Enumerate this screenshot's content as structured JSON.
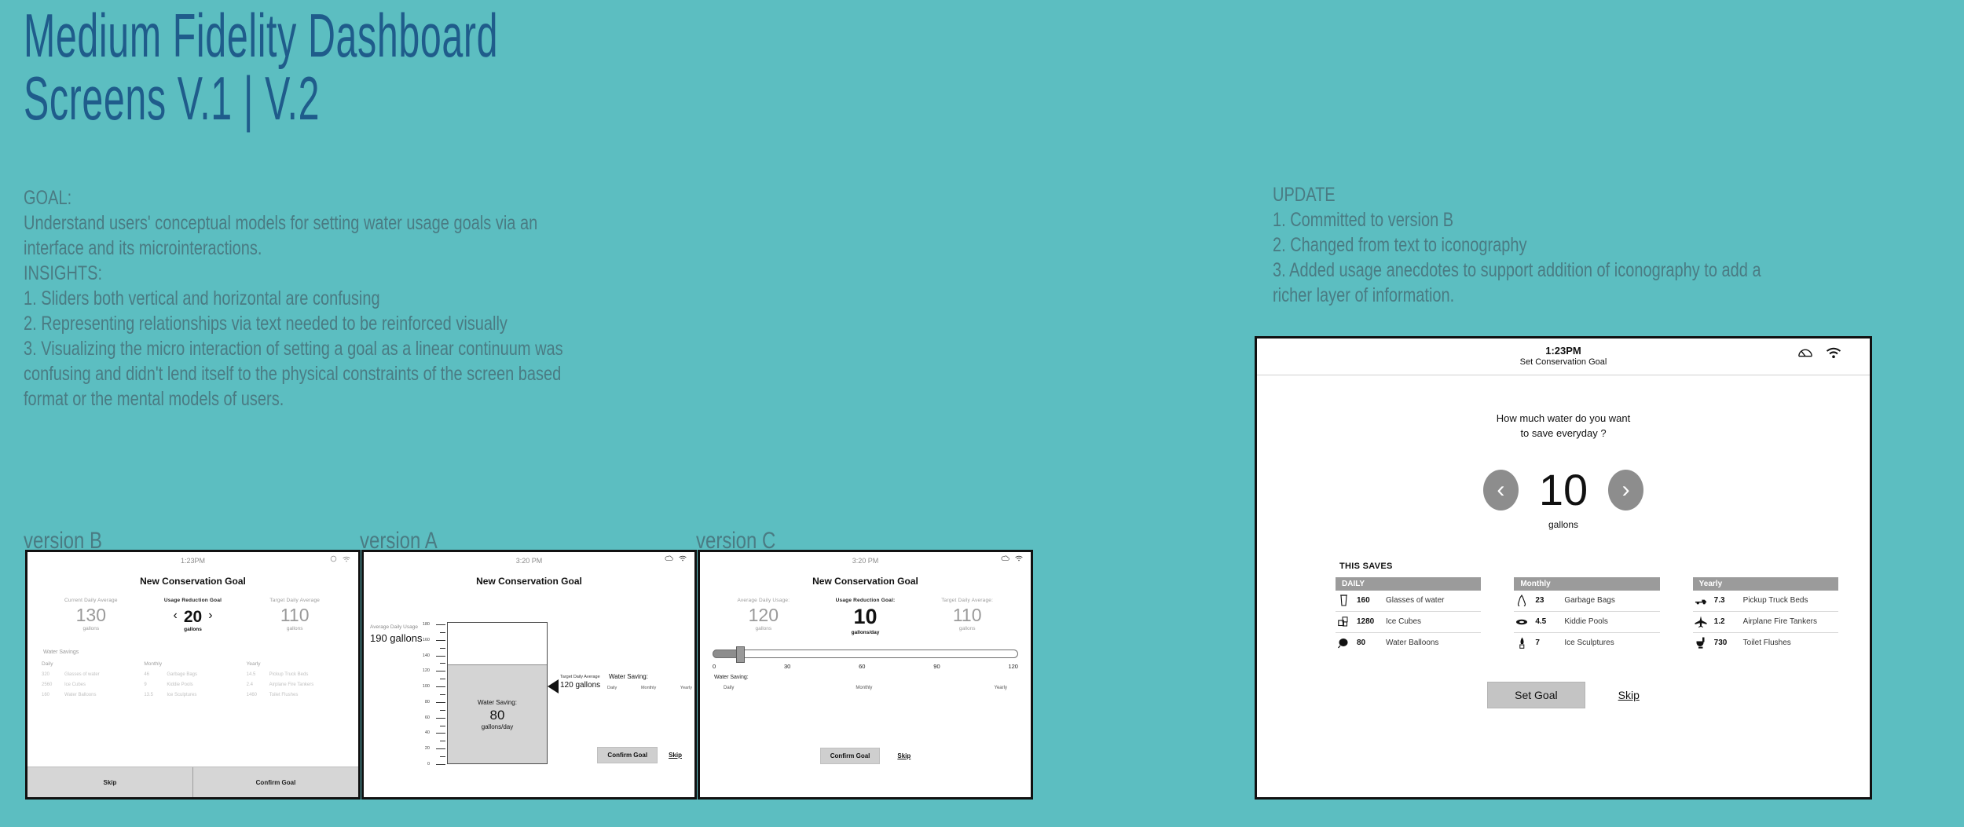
{
  "headline": "Medium Fidelity Dashboard\nScreens V.1 | V.2",
  "goal_copy": "GOAL:\nUnderstand users' conceptual models for setting water usage goals via an interface and its microinteractions.\nINSIGHTS:\n1. Sliders both vertical and horizontal are confusing\n2. Representing relationships via text needed to be reinforced visually\n3. Visualizing the micro interaction of setting a goal as a linear continuum  was confusing and didn't lend itself to the physical constraints of the screen based format or the mental models of users.",
  "update_copy": "UPDATE\n1. Committed to version B\n2. Changed from text to iconography\n3. Added usage anecdotes to support addition of iconography to add a richer layer of information.",
  "labels": {
    "version_b": "version B",
    "version_a": "version A",
    "version_c": "version C"
  },
  "version_b": {
    "status_time": "1:23PM",
    "title": "New Conservation Goal",
    "current": {
      "caption": "Current Daily Average",
      "value": "130",
      "unit": "gallons"
    },
    "goal": {
      "caption": "Usage Reduction Goal",
      "value": "20",
      "unit": "gallons",
      "prev": "‹",
      "next": "›"
    },
    "target": {
      "caption": "Target Daily Average",
      "value": "110",
      "unit": "gallons"
    },
    "savings_header": "Water Savings",
    "columns": [
      "Daily",
      "Monthly",
      "Yearly"
    ],
    "daily": [
      {
        "value": "320",
        "label": "Glasses of water"
      },
      {
        "value": "2560",
        "label": "Ice Cubes"
      },
      {
        "value": "160",
        "label": "Water Balloons"
      }
    ],
    "monthly": [
      {
        "value": "46",
        "label": "Garbage Bags"
      },
      {
        "value": "9",
        "label": "Kiddie Pools"
      },
      {
        "value": "13.5",
        "label": "Ice Sculptures"
      }
    ],
    "yearly": [
      {
        "value": "14.5",
        "label": "Pickup Truck Beds"
      },
      {
        "value": "2.4",
        "label": "Airplane Fire Tankers"
      },
      {
        "value": "1460",
        "label": "Toilet Flushes"
      }
    ],
    "skip_label": "Skip",
    "confirm_label": "Confirm Goal"
  },
  "version_a": {
    "status_time": "3:20 PM",
    "title": "New Conservation Goal",
    "avg_caption": "Average Daily Usage",
    "avg_value": "190 gallons",
    "axis_ticks": [
      "180",
      "160",
      "140",
      "120",
      "100",
      "80",
      "60",
      "40",
      "20",
      "0"
    ],
    "pointer_caption": "Target Daily Average",
    "pointer_value": "120 gallons",
    "saving_label": "Water Saving:",
    "saving_value": "80",
    "saving_unit": "gallons/day",
    "savings_header": "Water Saving:",
    "columns": [
      "Daily",
      "Monthly",
      "Yearly"
    ],
    "confirm_label": "Confirm Goal",
    "skip_label": "Skip"
  },
  "version_c": {
    "status_time": "3:20 PM",
    "title": "New Conservation Goal",
    "current": {
      "caption": "Average Daily Usage:",
      "value": "120",
      "unit": "gallons"
    },
    "goal": {
      "caption": "Usage Reduction Goal:",
      "value": "10",
      "unit": "gallons/day"
    },
    "target": {
      "caption": "Target Daily Average:",
      "value": "110",
      "unit": "gallons"
    },
    "scale": [
      "0",
      "30",
      "60",
      "90",
      "120"
    ],
    "savings_header": "Water Saving:",
    "columns": [
      "Daily",
      "Monthly",
      "Yearly"
    ],
    "confirm_label": "Confirm Goal",
    "skip_label": "Skip"
  },
  "big": {
    "status_time": "1:23PM",
    "status_subtitle": "Set Conservation Goal",
    "question": "How much water do you want\nto save everyday ?",
    "prev_glyph": "‹",
    "next_glyph": "›",
    "value": "10",
    "unit": "gallons",
    "this_saves": "THIS SAVES",
    "col_daily_header": "DAILY",
    "col_monthly_header": "Monthly",
    "col_yearly_header": "Yearly",
    "daily": [
      {
        "icon": "glass-icon",
        "value": "160",
        "label": "Glasses of water"
      },
      {
        "icon": "ice-cubes-icon",
        "value": "1280",
        "label": "Ice Cubes"
      },
      {
        "icon": "water-balloon-icon",
        "value": "80",
        "label": "Water Balloons"
      }
    ],
    "monthly": [
      {
        "icon": "garbage-bag-icon",
        "value": "23",
        "label": "Garbage Bags"
      },
      {
        "icon": "kiddie-pool-icon",
        "value": "4.5",
        "label": "Kiddie Pools"
      },
      {
        "icon": "ice-sculpture-icon",
        "value": "7",
        "label": "Ice Sculptures"
      }
    ],
    "yearly": [
      {
        "icon": "pickup-truck-icon",
        "value": "7.3",
        "label": "Pickup Truck Beds"
      },
      {
        "icon": "airplane-icon",
        "value": "1.2",
        "label": "Airplane Fire Tankers"
      },
      {
        "icon": "toilet-icon",
        "value": "730",
        "label": "Toilet Flushes"
      }
    ],
    "set_goal_label": "Set Goal",
    "skip_label": "Skip"
  },
  "colors": {
    "background": "#5CBEC1",
    "headline": "#1F5C8B",
    "copy": "#4A7B83",
    "accent_gray": "#9b9b9b"
  }
}
